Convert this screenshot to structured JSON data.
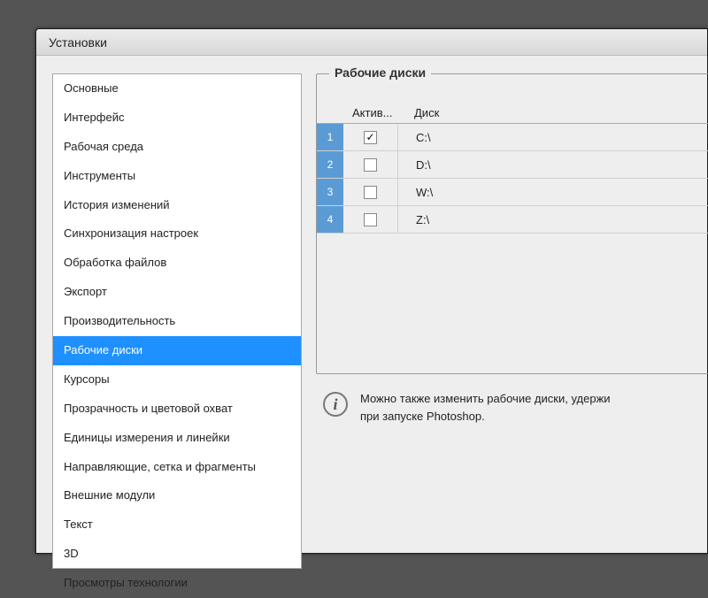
{
  "window": {
    "title": "Установки"
  },
  "sidebar": {
    "items": [
      {
        "label": "Основные"
      },
      {
        "label": "Интерфейс"
      },
      {
        "label": "Рабочая среда"
      },
      {
        "label": "Инструменты"
      },
      {
        "label": "История изменений"
      },
      {
        "label": "Синхронизация настроек"
      },
      {
        "label": "Обработка файлов"
      },
      {
        "label": "Экспорт"
      },
      {
        "label": "Производительность"
      },
      {
        "label": "Рабочие диски"
      },
      {
        "label": "Курсоры"
      },
      {
        "label": "Прозрачность и цветовой охват"
      },
      {
        "label": "Единицы измерения и линейки"
      },
      {
        "label": "Направляющие, сетка и фрагменты"
      },
      {
        "label": "Внешние модули"
      },
      {
        "label": "Текст"
      },
      {
        "label": "3D"
      },
      {
        "label": "Просмотры технологии"
      }
    ],
    "selected_index": 9
  },
  "panel": {
    "legend": "Рабочие диски",
    "headers": {
      "active": "Актив...",
      "drive": "Диск"
    },
    "rows": [
      {
        "num": "1",
        "active": true,
        "drive": "C:\\"
      },
      {
        "num": "2",
        "active": false,
        "drive": "D:\\"
      },
      {
        "num": "3",
        "active": false,
        "drive": "W:\\"
      },
      {
        "num": "4",
        "active": false,
        "drive": "Z:\\"
      }
    ],
    "info_line1": "Можно также изменить рабочие диски, удержи",
    "info_line2": "при запуске Photoshop.",
    "info_glyph": "i"
  }
}
